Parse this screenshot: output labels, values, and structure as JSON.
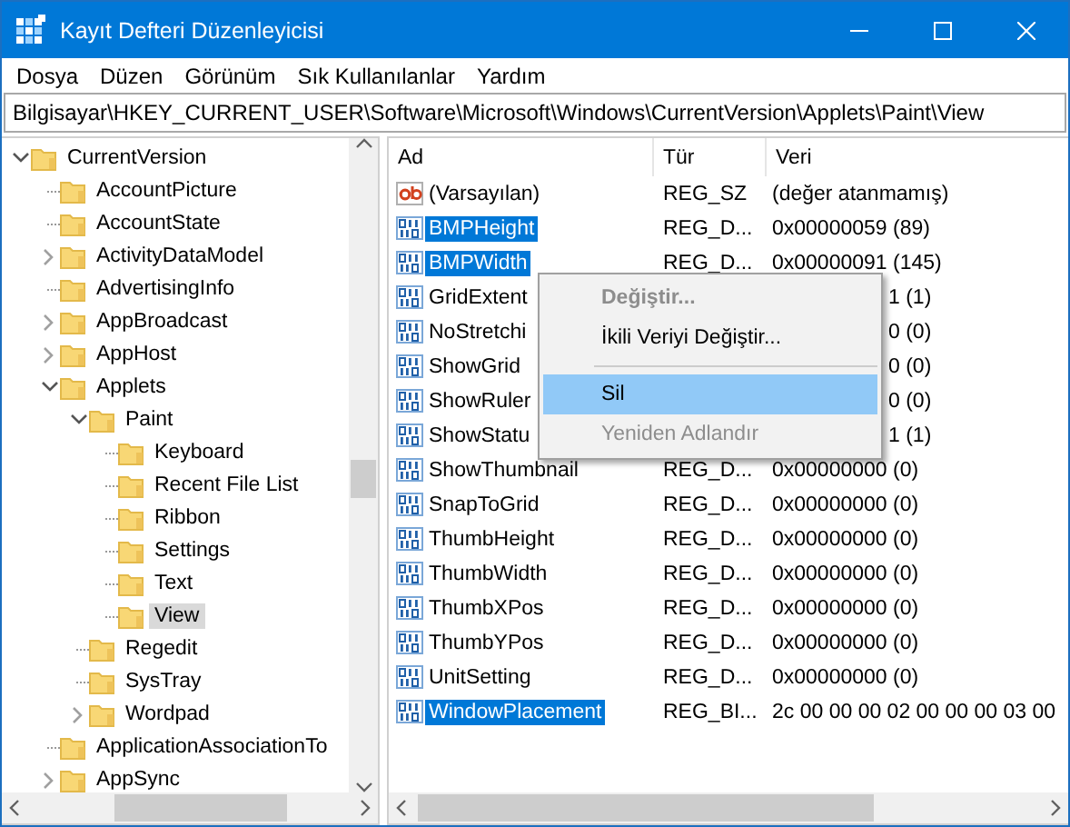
{
  "window": {
    "title": "Kayıt Defteri Düzenleyicisi"
  },
  "menu": [
    "Dosya",
    "Düzen",
    "Görünüm",
    "Sık Kullanılanlar",
    "Yardım"
  ],
  "address": "Bilgisayar\\HKEY_CURRENT_USER\\Software\\Microsoft\\Windows\\CurrentVersion\\Applets\\Paint\\View",
  "tree": [
    {
      "label": "CurrentVersion",
      "kind": "expanded",
      "selected": false,
      "children": [
        {
          "label": "AccountPicture",
          "kind": "leaf",
          "selected": false
        },
        {
          "label": "AccountState",
          "kind": "leaf",
          "selected": false
        },
        {
          "label": "ActivityDataModel",
          "kind": "collapsed",
          "selected": false
        },
        {
          "label": "AdvertisingInfo",
          "kind": "leaf",
          "selected": false
        },
        {
          "label": "AppBroadcast",
          "kind": "collapsed",
          "selected": false
        },
        {
          "label": "AppHost",
          "kind": "collapsed",
          "selected": false
        },
        {
          "label": "Applets",
          "kind": "expanded",
          "selected": false,
          "children": [
            {
              "label": "Paint",
              "kind": "expanded",
              "selected": false,
              "children": [
                {
                  "label": "Keyboard",
                  "kind": "leaf",
                  "selected": false
                },
                {
                  "label": "Recent File List",
                  "kind": "leaf",
                  "selected": false
                },
                {
                  "label": "Ribbon",
                  "kind": "leaf",
                  "selected": false
                },
                {
                  "label": "Settings",
                  "kind": "leaf",
                  "selected": false
                },
                {
                  "label": "Text",
                  "kind": "leaf",
                  "selected": false
                },
                {
                  "label": "View",
                  "kind": "leaf",
                  "selected": true
                }
              ]
            },
            {
              "label": "Regedit",
              "kind": "leaf",
              "selected": false
            },
            {
              "label": "SysTray",
              "kind": "leaf",
              "selected": false
            },
            {
              "label": "Wordpad",
              "kind": "collapsed",
              "selected": false
            }
          ]
        },
        {
          "label": "ApplicationAssociationTo",
          "kind": "leaf",
          "selected": false
        },
        {
          "label": "AppSync",
          "kind": "collapsed",
          "selected": false
        }
      ]
    }
  ],
  "columns": [
    "Ad",
    "Tür",
    "Veri"
  ],
  "values": [
    {
      "name": "(Varsayılan)",
      "kind": "string",
      "type": "REG_SZ",
      "data": "(değer atanmamış)",
      "selected": false,
      "covered": false
    },
    {
      "name": "BMPHeight",
      "kind": "binary",
      "type": "REG_D...",
      "data": "0x00000059 (89)",
      "selected": true,
      "covered": false
    },
    {
      "name": "BMPWidth",
      "kind": "binary",
      "type": "REG_D...",
      "data": "0x00000091 (145)",
      "selected": true,
      "covered": false
    },
    {
      "name": "GridExtent",
      "kind": "binary",
      "data": "1 (1)",
      "selected": false,
      "covered": true
    },
    {
      "name": "NoStretchi",
      "kind": "binary",
      "data": "0 (0)",
      "selected": false,
      "covered": true
    },
    {
      "name": "ShowGrid",
      "kind": "binary",
      "data": "0 (0)",
      "selected": false,
      "covered": true
    },
    {
      "name": "ShowRuler",
      "kind": "binary",
      "data": "0 (0)",
      "selected": false,
      "covered": true
    },
    {
      "name": "ShowStatu",
      "kind": "binary",
      "data": "1 (1)",
      "selected": false,
      "covered": true
    },
    {
      "name": "ShowThumbnail",
      "kind": "binary",
      "type": "REG_D...",
      "data": "0x00000000 (0)",
      "selected": false,
      "covered": false
    },
    {
      "name": "SnapToGrid",
      "kind": "binary",
      "type": "REG_D...",
      "data": "0x00000000 (0)",
      "selected": false,
      "covered": false
    },
    {
      "name": "ThumbHeight",
      "kind": "binary",
      "type": "REG_D...",
      "data": "0x00000000 (0)",
      "selected": false,
      "covered": false
    },
    {
      "name": "ThumbWidth",
      "kind": "binary",
      "type": "REG_D...",
      "data": "0x00000000 (0)",
      "selected": false,
      "covered": false
    },
    {
      "name": "ThumbXPos",
      "kind": "binary",
      "type": "REG_D...",
      "data": "0x00000000 (0)",
      "selected": false,
      "covered": false
    },
    {
      "name": "ThumbYPos",
      "kind": "binary",
      "type": "REG_D...",
      "data": "0x00000000 (0)",
      "selected": false,
      "covered": false
    },
    {
      "name": "UnitSetting",
      "kind": "binary",
      "type": "REG_D...",
      "data": "0x00000000 (0)",
      "selected": false,
      "covered": false
    },
    {
      "name": "WindowPlacement",
      "kind": "binary",
      "type": "REG_BI...",
      "data": "2c 00 00 00 02 00 00 00 03 00",
      "selected": true,
      "covered": false
    }
  ],
  "context_menu": [
    {
      "label": "Değiştir...",
      "kind": "item",
      "default": true,
      "disabled": true,
      "selected": false
    },
    {
      "label": "İkili Veriyi Değiştir...",
      "kind": "item",
      "default": false,
      "disabled": false,
      "selected": false
    },
    {
      "kind": "separator"
    },
    {
      "label": "Sil",
      "kind": "item",
      "default": false,
      "disabled": false,
      "selected": true
    },
    {
      "label": "Yeniden Adlandır",
      "kind": "item",
      "default": false,
      "disabled": true,
      "selected": false
    }
  ]
}
